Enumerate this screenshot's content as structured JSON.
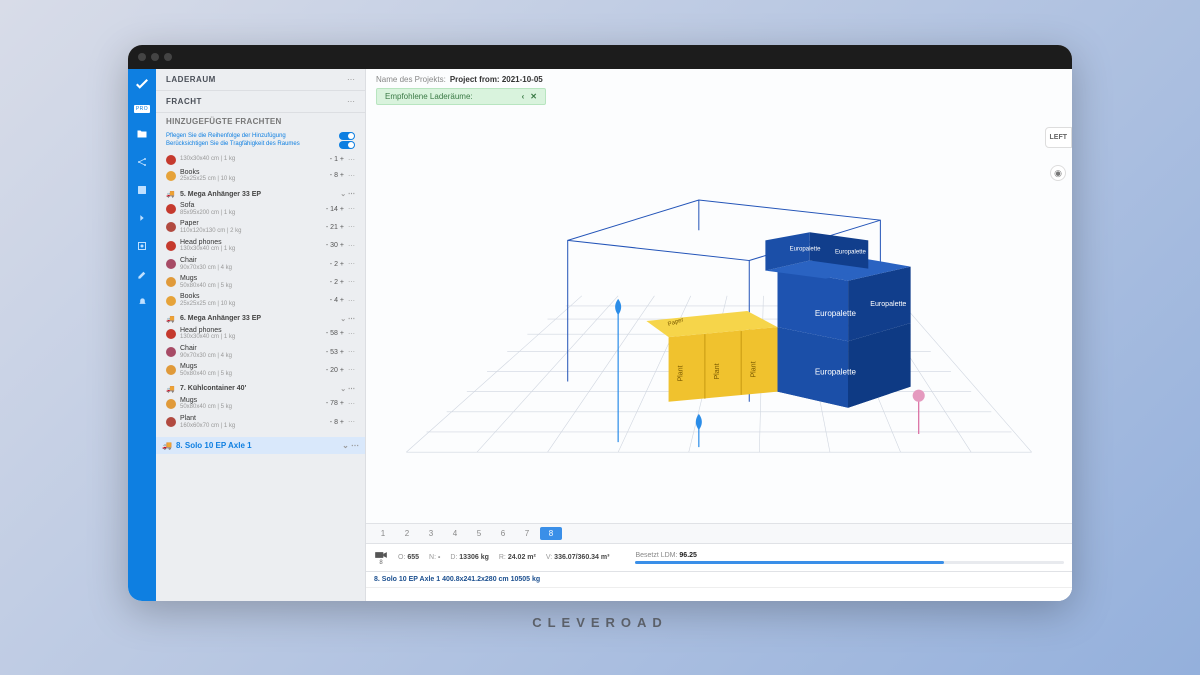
{
  "brand": "CLEVEROAD",
  "nav": {
    "logo_sub": "PRO"
  },
  "sidebar": {
    "section_laderaum": "LADERAUM",
    "section_fracht": "FRACHT",
    "section_added": "HINZUGEFÜGTE FRACHTEN",
    "toggle1": "Pflegen Sie die Reihenfolge der Hinzufügung",
    "toggle2": "Berücksichtigen Sie die Tragfähigkeit des Raumes",
    "groups": [
      {
        "items": [
          {
            "name": "",
            "dims": "130x30x40 cm | 1 kg",
            "qty": "1",
            "swatch": "#c53a2e"
          },
          {
            "name": "Books",
            "dims": "25x25x25 cm | 10 kg",
            "qty": "8",
            "swatch": "#e6a33a"
          }
        ]
      },
      {
        "header": "5. Mega Anhänger 33 EP",
        "items": [
          {
            "name": "Sofa",
            "dims": "85x95x200 cm | 1 kg",
            "qty": "14",
            "swatch": "#c53a2e"
          },
          {
            "name": "Paper",
            "dims": "110x120x130 cm | 2 kg",
            "qty": "21",
            "swatch": "#b14a40"
          },
          {
            "name": "Head phones",
            "dims": "130x30x40 cm | 1 kg",
            "qty": "30",
            "swatch": "#c53a2e"
          },
          {
            "name": "Chair",
            "dims": "90x70x30 cm | 4 kg",
            "qty": "2",
            "swatch": "#a74b66"
          },
          {
            "name": "Mugs",
            "dims": "50x80x40 cm | 5 kg",
            "qty": "2",
            "swatch": "#e09a3a"
          },
          {
            "name": "Books",
            "dims": "25x25x25 cm | 10 kg",
            "qty": "4",
            "swatch": "#e6a33a"
          }
        ]
      },
      {
        "header": "6. Mega Anhänger 33 EP",
        "items": [
          {
            "name": "Head phones",
            "dims": "130x30x40 cm | 1 kg",
            "qty": "58",
            "swatch": "#c53a2e"
          },
          {
            "name": "Chair",
            "dims": "90x70x30 cm | 4 kg",
            "qty": "53",
            "swatch": "#a74b66"
          },
          {
            "name": "Mugs",
            "dims": "50x80x40 cm | 5 kg",
            "qty": "20",
            "swatch": "#e09a3a"
          }
        ]
      },
      {
        "header": "7. Kühlcontainer 40'",
        "items": [
          {
            "name": "Mugs",
            "dims": "50x80x40 cm | 5 kg",
            "qty": "78",
            "swatch": "#e09a3a"
          },
          {
            "name": "Plant",
            "dims": "160x60x70 cm | 1 kg",
            "qty": "8",
            "swatch": "#b14a40"
          }
        ]
      }
    ],
    "selected_row": "8. Solo 10 EP Axle 1"
  },
  "main": {
    "project_label": "Name des Projekts:",
    "project_value": "Project from: 2021-10-05",
    "hint": "Empfohlene Laderäume:",
    "side_btn": "LEFT",
    "pallet_label": "Europalette",
    "box_labels": {
      "plant": "Plant",
      "paper": "Paper"
    }
  },
  "stepper": {
    "steps": [
      "1",
      "2",
      "3",
      "4",
      "5",
      "6",
      "7",
      "8"
    ],
    "active": 8
  },
  "stats": {
    "cam": "8",
    "o_k": "O:",
    "o_v": "655",
    "n_k": "N:",
    "n_v": "-",
    "d_k": "D:",
    "d_v": "13306 kg",
    "r_k": "R:",
    "r_v": "24.02 m²",
    "v_k": "V:",
    "v_v": "336.07/360.34 m³",
    "ldm_label": "Besetzt LDM:",
    "ldm_value": "96.25"
  },
  "axle": "8. Solo 10 EP Axle 1 400.8x241.2x280 cm 10505 kg"
}
